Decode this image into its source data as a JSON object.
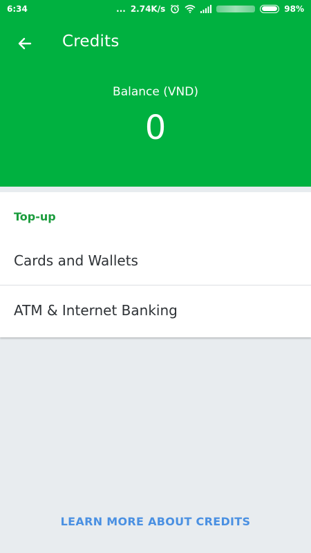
{
  "status_bar": {
    "time": "6:34",
    "dots": "...",
    "network_speed": "2.74K/s",
    "battery": "98%",
    "battery_level": 0.98,
    "icons": [
      "alarm-icon",
      "wifi-icon",
      "signal-icon",
      "battery-icon"
    ]
  },
  "header": {
    "title": "Credits",
    "balance_label": "Balance (VND)",
    "balance_value": "0",
    "background_color": "#00b140"
  },
  "topup": {
    "section_title": "Top-up",
    "items": [
      {
        "label": "Cards and Wallets"
      },
      {
        "label": "ATM & Internet Banking"
      }
    ]
  },
  "footer": {
    "learn_more_label": "LEARN MORE ABOUT CREDITS",
    "link_color": "#4a90e2"
  }
}
